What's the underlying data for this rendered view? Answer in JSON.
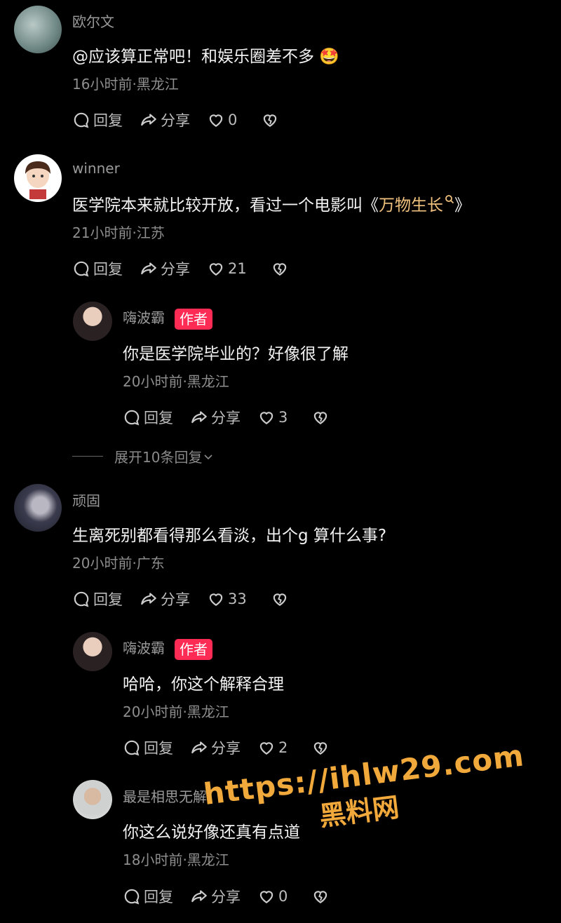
{
  "comments": [
    {
      "username": "欧尔文",
      "text": "@应该算正常吧！和娱乐圈差不多 🤩",
      "meta": "16小时前·黑龙江",
      "reply_label": "回复",
      "share_label": "分享",
      "likes": "0"
    },
    {
      "username": "winner",
      "text_prefix": "医学院本来就比较开放，看过一个电影叫《",
      "link_text": "万物生长",
      "text_suffix": "》",
      "meta": "21小时前·江苏",
      "reply_label": "回复",
      "share_label": "分享",
      "likes": "21",
      "replies": [
        {
          "username": "嗨波霸",
          "author_tag": "作者",
          "text": "你是医学院毕业的？好像很了解",
          "meta": "20小时前·黑龙江",
          "reply_label": "回复",
          "share_label": "分享",
          "likes": "3"
        }
      ],
      "expand_label": "展开10条回复"
    },
    {
      "username": "顽固",
      "text": "生离死别都看得那么看淡，出个g 算什么事?",
      "meta": "20小时前·广东",
      "reply_label": "回复",
      "share_label": "分享",
      "likes": "33",
      "replies": [
        {
          "username": "嗨波霸",
          "author_tag": "作者",
          "text": "哈哈，你这个解释合理",
          "meta": "20小时前·黑龙江",
          "reply_label": "回复",
          "share_label": "分享",
          "likes": "2"
        },
        {
          "username": "最是相思无解",
          "text": "你这么说好像还真有点道",
          "meta": "18小时前·黑龙江",
          "reply_label": "回复",
          "share_label": "分享",
          "likes": "0"
        }
      ]
    }
  ],
  "watermark": {
    "url": "https://ihlw29.com",
    "label": "黑料网"
  },
  "icons": {
    "reply": "comment-bubble-icon",
    "share": "share-arrow-icon",
    "like": "heart-icon",
    "dislike": "broken-heart-icon",
    "search": "search-icon",
    "expand": "chevron-down-icon"
  },
  "colors": {
    "background": "#000000",
    "author_tag": "#fe2c55",
    "link": "#f1c27d",
    "watermark": "#f2a93b"
  }
}
